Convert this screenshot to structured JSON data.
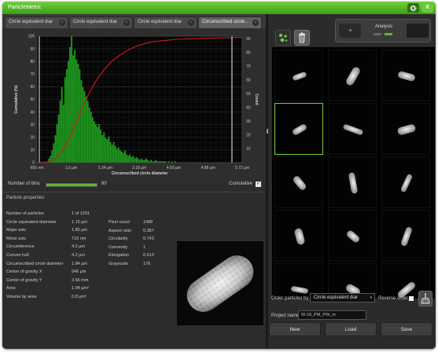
{
  "window": {
    "title": "ParticleMetric",
    "settings_icon": "settings-icon",
    "close_label": "X"
  },
  "tabs": [
    {
      "label": "Circle equivalent diar"
    },
    {
      "label": "Circle equivalent diar"
    },
    {
      "label": "Circle equivalent diar"
    },
    {
      "label": "Circumscribed circle..."
    }
  ],
  "tab_close_label": "×",
  "colors": {
    "accent": "#5cb82a",
    "histogram_bar": "#1f9e1f",
    "cumulative_curve": "#d01c1c",
    "selected_cell_border": "#7fcf3c"
  },
  "chart_data": {
    "type": "bar",
    "xlabel": "Circumscribed circle diameter",
    "ylabel": "Cumulative (%)",
    "y2label": "Count",
    "x_ticks": [
      "656 nm",
      "1.5 µm",
      "2.34 µm",
      "3.18 µm",
      "4.03 µm",
      "4.88 µm",
      "5.72 µm"
    ],
    "xlim": [
      0.656,
      5.72
    ],
    "x_tick_values": [
      0.656,
      1.5,
      2.34,
      3.18,
      4.03,
      4.88,
      5.72
    ],
    "ylim": [
      0,
      100
    ],
    "y_ticks": [
      0,
      10,
      20,
      30,
      40,
      50,
      60,
      70,
      80,
      90,
      100
    ],
    "y2lim": [
      0,
      92
    ],
    "y2_ticks": [
      10,
      20,
      30,
      40,
      50,
      60,
      70,
      80,
      90
    ],
    "grid": true,
    "series": [
      {
        "kind": "histogram",
        "bin_centers": [
          0.95,
          0.99,
          1.03,
          1.07,
          1.11,
          1.15,
          1.19,
          1.23,
          1.27,
          1.31,
          1.35,
          1.39,
          1.43,
          1.47,
          1.51,
          1.55,
          1.59,
          1.63,
          1.67,
          1.71,
          1.75,
          1.79,
          1.83,
          1.87,
          1.91,
          1.95,
          1.99,
          2.03,
          2.07,
          2.11,
          2.15,
          2.19,
          2.23,
          2.27,
          2.31,
          2.35,
          2.39,
          2.43,
          2.47,
          2.51,
          2.55,
          2.59,
          2.63,
          2.67,
          2.71,
          2.75,
          2.79,
          2.83,
          2.87,
          2.91,
          2.95,
          2.99,
          3.03,
          3.07,
          3.11,
          3.15,
          3.19,
          3.23,
          3.27,
          3.31,
          3.35,
          3.39,
          3.43,
          3.47,
          3.51,
          3.55,
          3.59,
          3.63,
          3.67,
          3.71,
          3.75,
          3.79,
          3.83,
          3.87,
          3.91,
          3.95,
          3.99,
          4.03,
          4.07,
          4.11
        ],
        "values": [
          3,
          5,
          9,
          14,
          20,
          28,
          35,
          45,
          55,
          42,
          62,
          68,
          74,
          84,
          92,
          78,
          82,
          75,
          72,
          68,
          60,
          55,
          52,
          48,
          45,
          40,
          37,
          33,
          30,
          28,
          26,
          28,
          24,
          20,
          22,
          18,
          17,
          19,
          15,
          13,
          15,
          12,
          10,
          11,
          9,
          8,
          7,
          9,
          6,
          5,
          6,
          4,
          5,
          3,
          4,
          3,
          2,
          3,
          2,
          2,
          3,
          2,
          1,
          2,
          1,
          1,
          2,
          1,
          1,
          1,
          1,
          1,
          1,
          0,
          1,
          0,
          1,
          0,
          1,
          0
        ]
      },
      {
        "kind": "cumulative",
        "x": [
          0.656,
          0.9,
          1.1,
          1.3,
          1.5,
          1.7,
          1.9,
          2.1,
          2.3,
          2.5,
          2.7,
          2.9,
          3.1,
          3.3,
          3.5,
          3.8,
          4.1,
          4.5,
          5.0,
          5.72
        ],
        "values": [
          0,
          0.5,
          3,
          10,
          22,
          38,
          52,
          64,
          73,
          80,
          85,
          89,
          92,
          94,
          95.5,
          96.5,
          97.5,
          98,
          98.5,
          99
        ]
      }
    ]
  },
  "bins": {
    "label": "Number of bins",
    "value": "60",
    "fill_fraction": 1.0
  },
  "cumulative_toggle": {
    "label": "Cumulative",
    "checked_glyph": "✓"
  },
  "properties": {
    "title": "Particle properties",
    "left": [
      {
        "label": "Number of particles",
        "value": "1 of 1201"
      },
      {
        "label": "Circle equivalent diameter",
        "value": "1.15 µm"
      },
      {
        "label": "Major axis",
        "value": "1.85 µm"
      },
      {
        "label": "Minor axis",
        "value": "716 nm"
      },
      {
        "label": "Circumference",
        "value": "4.2 µm"
      },
      {
        "label": "Convex hull",
        "value": "4.2 µm"
      },
      {
        "label": "Circumscribed circle diameter",
        "value": "1.84 µm"
      },
      {
        "label": "Center of gravity X",
        "value": "546 µm"
      },
      {
        "label": "Center of gravity Y",
        "value": "3.65 mm"
      },
      {
        "label": "Area",
        "value": "1.04 µm²"
      },
      {
        "label": "Volume by area",
        "value": "0.8 µm³"
      }
    ],
    "right": [
      {
        "label": "Pixel count",
        "value": "1488"
      },
      {
        "label": "Aspect ratio",
        "value": "0.387"
      },
      {
        "label": "Circularity",
        "value": "0.743"
      },
      {
        "label": "Convexity",
        "value": "1"
      },
      {
        "label": "Elongation",
        "value": "0.613"
      },
      {
        "label": "Grayscale",
        "value": "176"
      }
    ]
  },
  "analysis": {
    "title": "Analysis",
    "prev_glyph": "◂",
    "prev_icon": "chevron-left-icon"
  },
  "toolbar": {
    "particles_icon": "particles-icon",
    "trash_icon": "trash-icon"
  },
  "particle_grid": {
    "columns": 3,
    "selected_index": 3,
    "rotations_deg": [
      -20,
      -60,
      15,
      -30,
      20,
      -15,
      50,
      80,
      -65,
      75,
      40,
      -70,
      10,
      30,
      -40
    ]
  },
  "controls": {
    "order_label": "Order particles by",
    "order_value": "Circle equivalent diar",
    "order_arrow": "▾",
    "reverse_label": "Reverse order",
    "broom_icon": "broom-icon",
    "project_label": "Project name",
    "project_value": "W-18_PM_PW_m",
    "new_label": "New",
    "load_label": "Load",
    "save_label": "Save"
  }
}
